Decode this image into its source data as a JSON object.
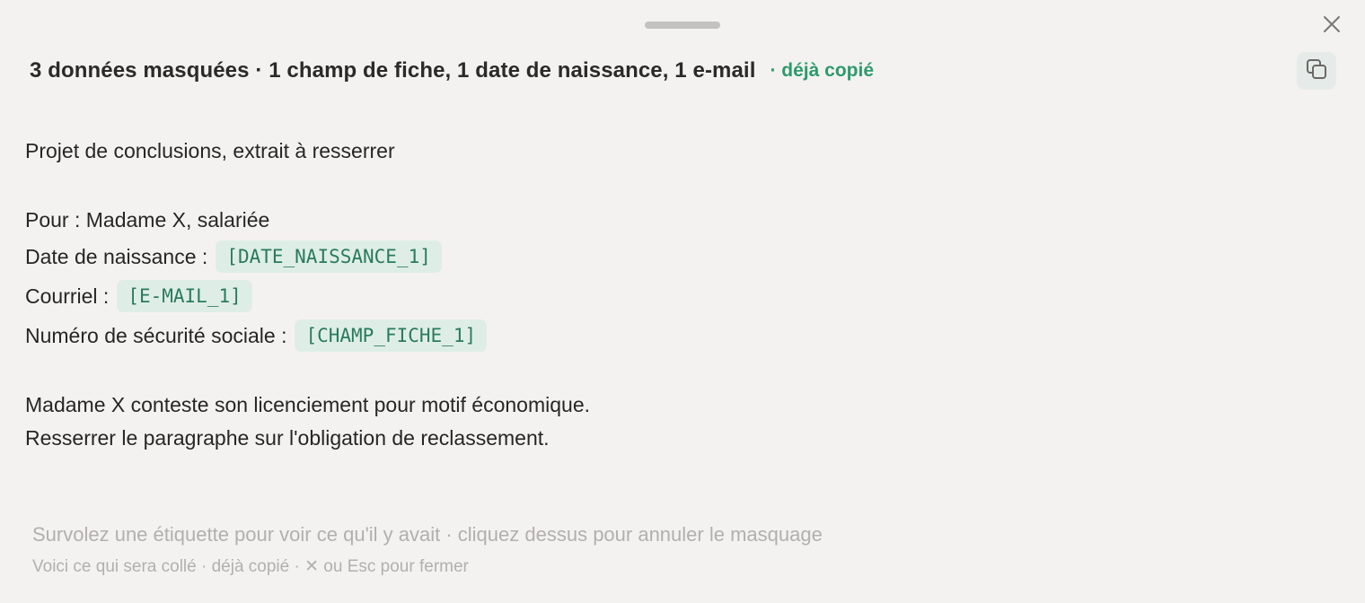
{
  "header": {
    "summary": "3 données masquées · 1 champ de fiche, 1 date de naissance, 1 e-mail",
    "copied_status": "· déjà copié"
  },
  "icons": {
    "close": "close-icon",
    "copy": "copy-icon"
  },
  "content": {
    "title": "Projet de conclusions, extrait à resserrer",
    "pour_line": "Pour : Madame X, salariée",
    "fields": [
      {
        "label": "Date de naissance :",
        "tag": "[DATE_NAISSANCE_1]"
      },
      {
        "label": "Courriel :",
        "tag": "[E-MAIL_1]"
      },
      {
        "label": "Numéro de sécurité sociale :",
        "tag": "[CHAMP_FICHE_1]"
      }
    ],
    "body_lines": [
      "Madame X conteste son licenciement pour motif économique.",
      "Resserrer le paragraphe sur l'obligation de reclassement."
    ]
  },
  "hints": {
    "hover_hint": "Survolez une étiquette pour voir ce qu'il y avait · cliquez dessus pour annuler le masquage",
    "footer": "Voici ce qui sera collé · déjà copié · ✕ ou Esc pour fermer"
  },
  "colors": {
    "background": "#f4f2f0",
    "accent_green": "#2e9a6c",
    "tag_background": "#deeee6",
    "tag_text": "#2a7b5c",
    "muted_text": "#b2b0ae"
  }
}
